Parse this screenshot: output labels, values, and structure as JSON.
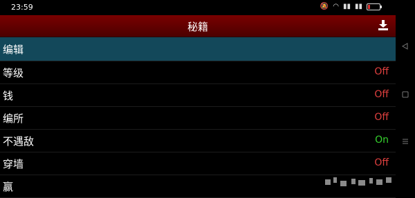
{
  "status": {
    "time": "23:59"
  },
  "header": {
    "title": "秘籍",
    "download_icon": "download-icon"
  },
  "rows": [
    {
      "label": "编辑",
      "value": "",
      "selected": true
    },
    {
      "label": "等级",
      "value": "Off"
    },
    {
      "label": "钱",
      "value": "Off"
    },
    {
      "label": "编所",
      "value": "Off"
    },
    {
      "label": "不遇敌",
      "value": "On"
    },
    {
      "label": "穿墙",
      "value": "Off"
    },
    {
      "label": "赢",
      "value": ""
    }
  ],
  "colors": {
    "header": "#6a0000",
    "selected_row": "#13485a",
    "off": "#e0403f",
    "on": "#35d12d"
  },
  "navigation": {
    "back_icon": "back-triangle-icon",
    "home_icon": "home-square-icon",
    "menu_icon": "menu-lines-icon"
  }
}
